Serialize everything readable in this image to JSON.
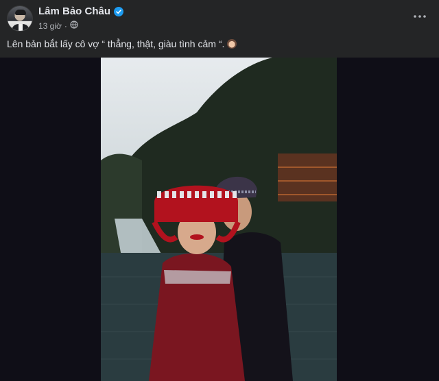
{
  "post": {
    "author_name": "Lâm Bảo Châu",
    "timestamp": "13 giờ",
    "caption": "Lên bản bắt lấy cô vợ “ thẳng, thật, giàu tình cảm “.",
    "caption_emoji": "woman-face-emoji",
    "verified_icon": "verified-badge-icon",
    "privacy_icon": "globe-icon",
    "menu_icon": "more-options-icon",
    "image_description": "photo"
  },
  "colors": {
    "background": "#242526",
    "text_primary": "#e4e6eb",
    "text_secondary": "#b0b3b8",
    "verified": "#1d9bf0",
    "media_backdrop": "#0f0e17"
  }
}
